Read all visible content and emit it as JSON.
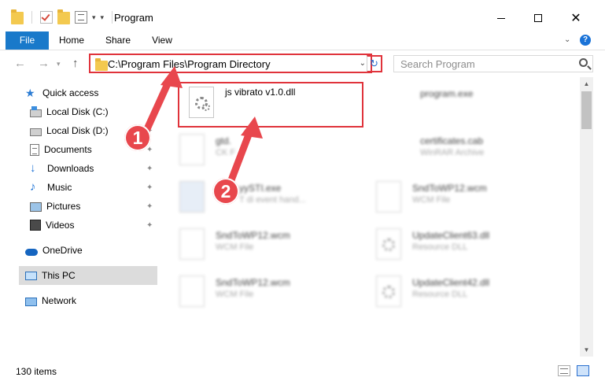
{
  "window": {
    "title": "Program",
    "colors": {
      "accent": "#1979ca",
      "annotation": "#e0333b"
    }
  },
  "ribbon": {
    "tabs": [
      {
        "label": "File"
      },
      {
        "label": "Home"
      },
      {
        "label": "Share"
      },
      {
        "label": "View"
      }
    ]
  },
  "address": {
    "path": "C:\\Program Files\\Program Directory",
    "search_placeholder": "Search Program"
  },
  "sidebar": {
    "items": [
      {
        "label": "Quick access",
        "icon": "star-icon"
      },
      {
        "label": "Local Disk (C:)",
        "icon": "drive-c-icon"
      },
      {
        "label": "Local Disk (D:)",
        "icon": "drive-icon"
      },
      {
        "label": "Documents",
        "icon": "documents-icon"
      },
      {
        "label": "Downloads",
        "icon": "downloads-icon"
      },
      {
        "label": "Music",
        "icon": "music-icon"
      },
      {
        "label": "Pictures",
        "icon": "pictures-icon"
      },
      {
        "label": "Videos",
        "icon": "videos-icon"
      },
      {
        "label": "OneDrive",
        "icon": "onedrive-icon"
      },
      {
        "label": "This PC",
        "icon": "this-pc-icon",
        "selected": true
      },
      {
        "label": "Network",
        "icon": "network-icon"
      }
    ]
  },
  "files": {
    "highlighted": {
      "name": "js vibrato v1.0.dll"
    },
    "left": [
      {
        "name": "gtd.",
        "type": "CK F"
      },
      {
        "name": "yySTI.exe",
        "type": "T di event hand..."
      },
      {
        "name": "SndToWP12.wcm",
        "type": "WCM File"
      },
      {
        "name": "SndToWP12.wcm",
        "type": "WCM File"
      }
    ],
    "right": [
      {
        "name": "program.exe",
        "type": ""
      },
      {
        "name": "certificates.cab",
        "type": "WinRAR Archive"
      },
      {
        "name": "SndToWP12.wcm",
        "type": "WCM File"
      },
      {
        "name": "UpdateClient63.dll",
        "type": "Resource DLL"
      },
      {
        "name": "UpdateClient42.dll",
        "type": "Resource DLL"
      }
    ]
  },
  "status": {
    "item_count": "130 items"
  },
  "callouts": {
    "step1": "1",
    "step2": "2"
  }
}
